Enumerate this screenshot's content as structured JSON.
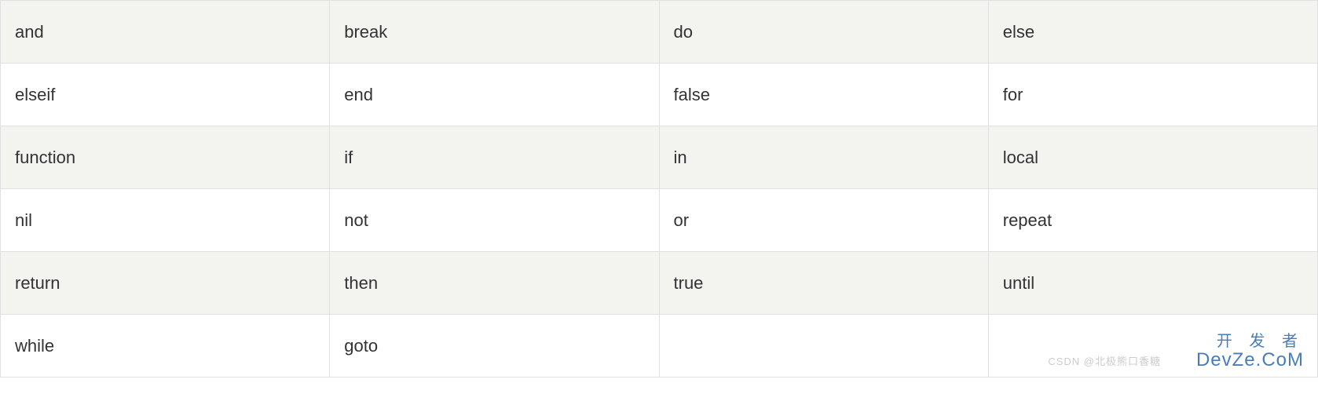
{
  "table": {
    "rows": [
      {
        "shaded": true,
        "cells": [
          "and",
          "break",
          "do",
          "else"
        ]
      },
      {
        "shaded": false,
        "cells": [
          "elseif",
          "end",
          "false",
          "for"
        ]
      },
      {
        "shaded": true,
        "cells": [
          "function",
          "if",
          "in",
          "local"
        ]
      },
      {
        "shaded": false,
        "cells": [
          "nil",
          "not",
          "or",
          "repeat"
        ]
      },
      {
        "shaded": true,
        "cells": [
          "return",
          "then",
          "true",
          "until"
        ]
      },
      {
        "shaded": false,
        "cells": [
          "while",
          "goto",
          "",
          ""
        ]
      }
    ]
  },
  "watermark": {
    "line1": "开 发 者",
    "line2": "DevZe.CoM",
    "sub": "CSDN @北极熊口香糖"
  }
}
